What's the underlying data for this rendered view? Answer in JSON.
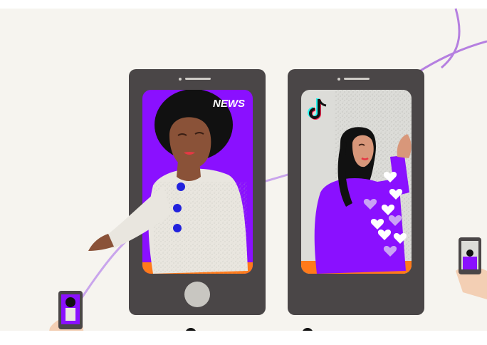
{
  "news_phone": {
    "news_label": "NEWS"
  },
  "social_phone": {
    "logo_icon": "tiktok-logo-icon"
  },
  "colors": {
    "background": "#f6f4ef",
    "phone_body": "#4a4647",
    "news_screen": "#8a10ff",
    "social_screen": "#dcdcd8",
    "sweater_purple": "#8a10ff",
    "heart_lilac": "#c9a3f4",
    "connector_line": "#b57fe0",
    "skin_dark": "#8a5238",
    "skin_light": "#d8977a",
    "shirt_white": "#e9e6df",
    "button_blue": "#2222dd",
    "orange": "#ff7a1a"
  }
}
